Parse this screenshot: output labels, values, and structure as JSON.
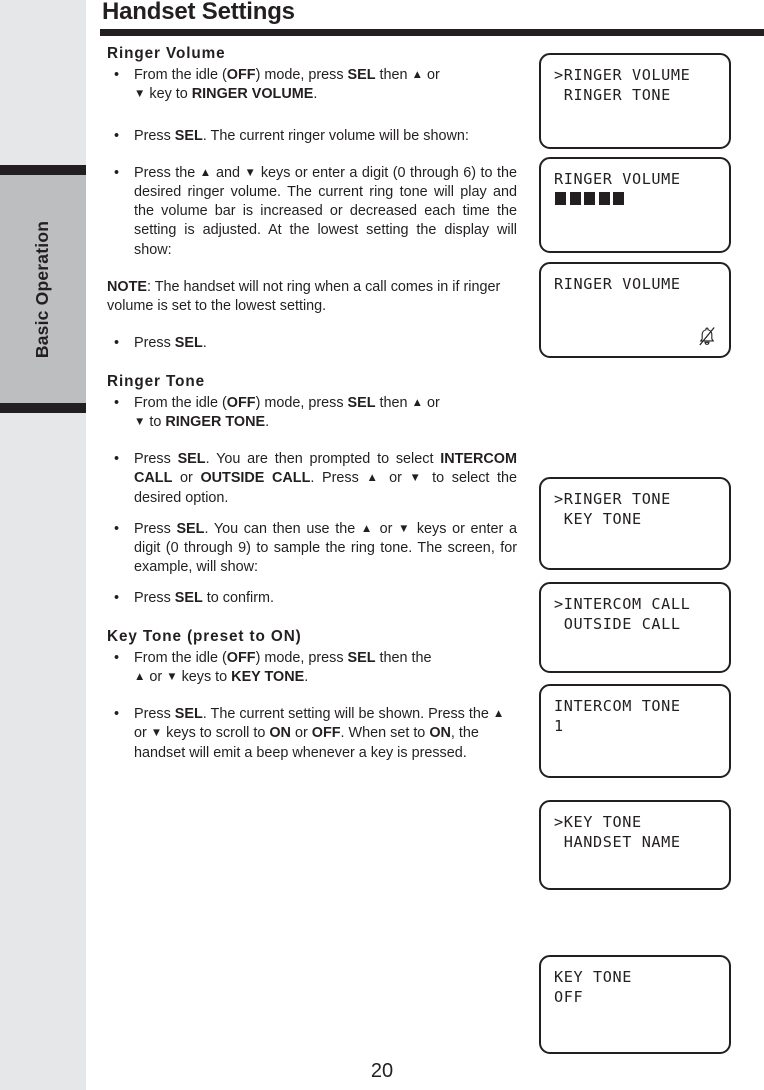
{
  "tab": {
    "label": "Basic Operation"
  },
  "header": {
    "title": "Handset Settings"
  },
  "footer": {
    "page_number": "20"
  },
  "sections": {
    "ringer_volume": {
      "heading": "Ringer Volume",
      "b1_a": "From the idle (",
      "b1_off": "OFF",
      "b1_b": ") mode, press ",
      "b1_sel": "SEL",
      "b1_c": " then ",
      "b1_up": "▲",
      "b1_d": " or ",
      "b1_down": "▼",
      "b1_e": " key to ",
      "b1_target": "RINGER VOLUME",
      "b1_f": ".",
      "b2_a": "Press ",
      "b2_sel": "SEL",
      "b2_b": ". The current ringer volume will be shown:",
      "b3_a": "Press the ",
      "b3_up": "▲",
      "b3_b": " and ",
      "b3_down": "▼",
      "b3_c": " keys or enter a digit (0 through 6) to the desired ringer volume. The current ring tone will play and the volume bar is increased or decreased each time the setting is adjusted. At the lowest setting the display will show:",
      "note_label": "NOTE",
      "note_text": ": The handset will not ring when a call comes in if ringer volume is set to the lowest setting.",
      "b4_a": "Press ",
      "b4_sel": "SEL",
      "b4_b": "."
    },
    "ringer_tone": {
      "heading": "Ringer Tone",
      "b1_a": "From the idle (",
      "b1_off": "OFF",
      "b1_b": ") mode, press ",
      "b1_sel": "SEL",
      "b1_c": " then ",
      "b1_up": "▲",
      "b1_d": " or ",
      "b1_down": "▼",
      "b1_e": " to ",
      "b1_target": "RINGER TONE",
      "b1_f": ".",
      "b2_a": " Press ",
      "b2_sel": "SEL",
      "b2_b": ". You are then prompted to select ",
      "b2_opt1": "INTERCOM CALL",
      "b2_c": " or ",
      "b2_opt2": "OUTSIDE CALL",
      "b2_d": ". Press ",
      "b2_up": "▲",
      "b2_e": " or ",
      "b2_down": "▼",
      "b2_f": " to select the desired option.",
      "b3_a": "Press ",
      "b3_sel": "SEL",
      "b3_b": ". You can then use the ",
      "b3_up": "▲",
      "b3_c": " or ",
      "b3_down": "▼",
      "b3_d": " keys or enter a digit (0 through 9) to sample the ring tone. The screen, for example, will show:",
      "b4_a": "Press ",
      "b4_sel": "SEL",
      "b4_b": " to confirm."
    },
    "key_tone": {
      "heading": "Key Tone (preset to ON)",
      "b1_a": "From the idle (",
      "b1_off": "OFF",
      "b1_b": ") mode, press ",
      "b1_sel": "SEL",
      "b1_c": " then the ",
      "b1_up": "▲",
      "b1_d": " or ",
      "b1_down": "▼",
      "b1_e": " keys to ",
      "b1_target": "KEY TONE",
      "b1_f": ".",
      "b2_a": "Press ",
      "b2_sel": "SEL",
      "b2_b": ". The current setting will be shown. Press the ",
      "b2_up": "▲",
      "b2_c": " or ",
      "b2_down": "▼",
      "b2_d": " keys to scroll to ",
      "b2_on": "ON",
      "b2_e": " or ",
      "b2_off": "OFF",
      "b2_f": ". When set to ",
      "b2_on2": "ON",
      "b2_g": ", the handset will emit a beep whenever a key is pressed."
    }
  },
  "lcd_screens": [
    {
      "name": "ringer-volume-menu",
      "line1": ">RINGER VOLUME",
      "line2": " RINGER TONE"
    },
    {
      "name": "ringer-volume-level",
      "line1": "RINGER VOLUME",
      "bars": 5
    },
    {
      "name": "ringer-volume-muted",
      "line1": "RINGER VOLUME",
      "icon": "bell-off-icon"
    },
    {
      "name": "ringer-tone-menu",
      "line1": ">RINGER TONE",
      "line2": " KEY TONE"
    },
    {
      "name": "call-type-menu",
      "line1": ">INTERCOM CALL",
      "line2": " OUTSIDE CALL"
    },
    {
      "name": "intercom-tone-value",
      "line1": "INTERCOM TONE",
      "line2": "1"
    },
    {
      "name": "key-tone-menu",
      "line1": ">KEY TONE",
      "line2": " HANDSET NAME"
    },
    {
      "name": "key-tone-value",
      "line1": "KEY TONE",
      "line2": "OFF"
    }
  ]
}
